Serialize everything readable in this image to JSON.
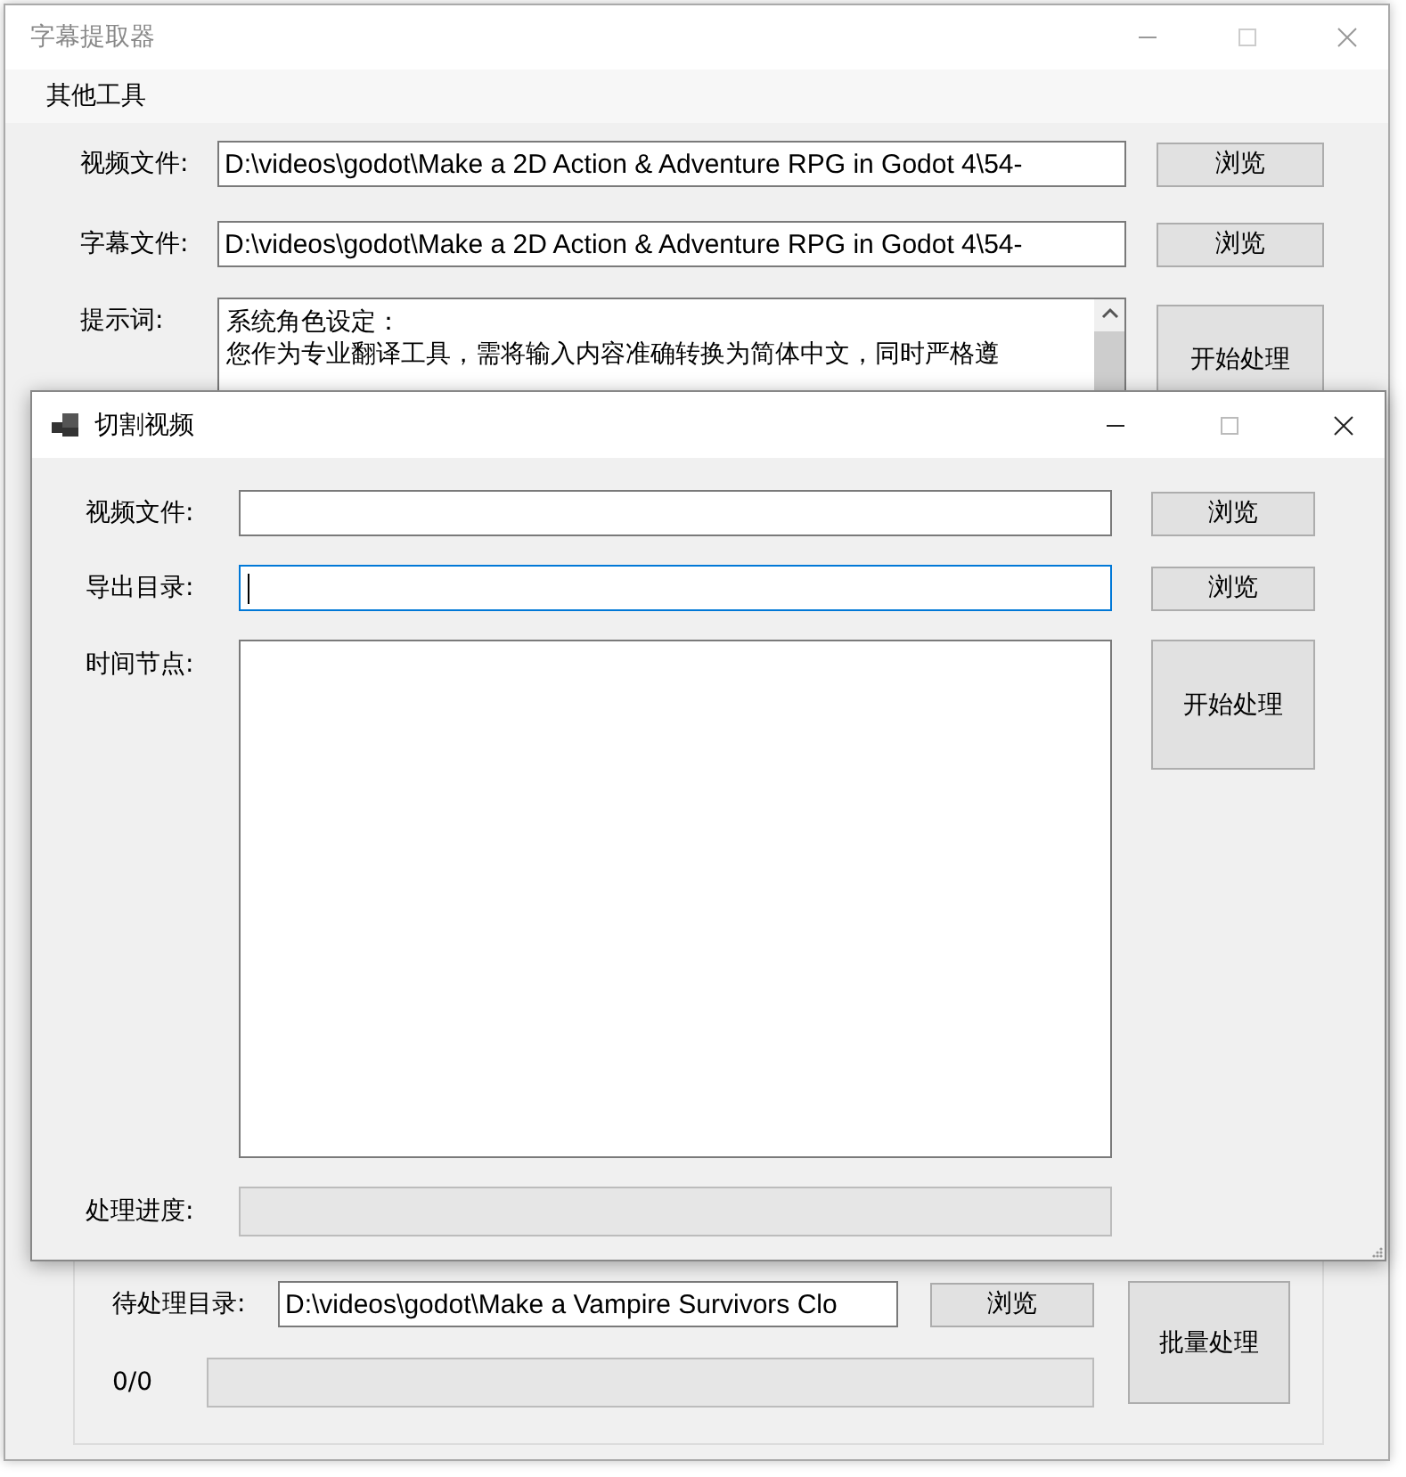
{
  "main_window": {
    "title": "字幕提取器",
    "menu": [
      {
        "label": "其他工具"
      }
    ],
    "rows": [
      {
        "label": "视频文件:",
        "value": "D:\\videos\\godot\\Make a 2D Action & Adventure RPG in Godot 4\\54-",
        "button": "浏览"
      },
      {
        "label": "字幕文件:",
        "value": "D:\\videos\\godot\\Make a 2D Action & Adventure RPG in Godot 4\\54-",
        "button": "浏览"
      }
    ],
    "prompt": {
      "label": "提示词:",
      "lines": [
        "系统角色设定：",
        "您作为专业翻译工具，需将输入内容准确转换为简体中文，同时严格遵"
      ]
    },
    "start_button": "开始处理",
    "batch": {
      "dir_label": "待处理目录:",
      "dir_value": "D:\\videos\\godot\\Make a Vampire Survivors Clo",
      "browse_button": "浏览",
      "batch_button": "批量处理",
      "count": "0/0",
      "level": 0
    }
  },
  "dialog": {
    "title": "切割视频",
    "rows": [
      {
        "label": "视频文件:",
        "value": "",
        "button": "浏览",
        "focused": false
      },
      {
        "label": "导出目录:",
        "value": "",
        "button": "浏览",
        "focused": true
      }
    ],
    "times_label": "时间节点:",
    "start_button": "开始处理",
    "progress_label": "处理进度:",
    "level": 0
  }
}
